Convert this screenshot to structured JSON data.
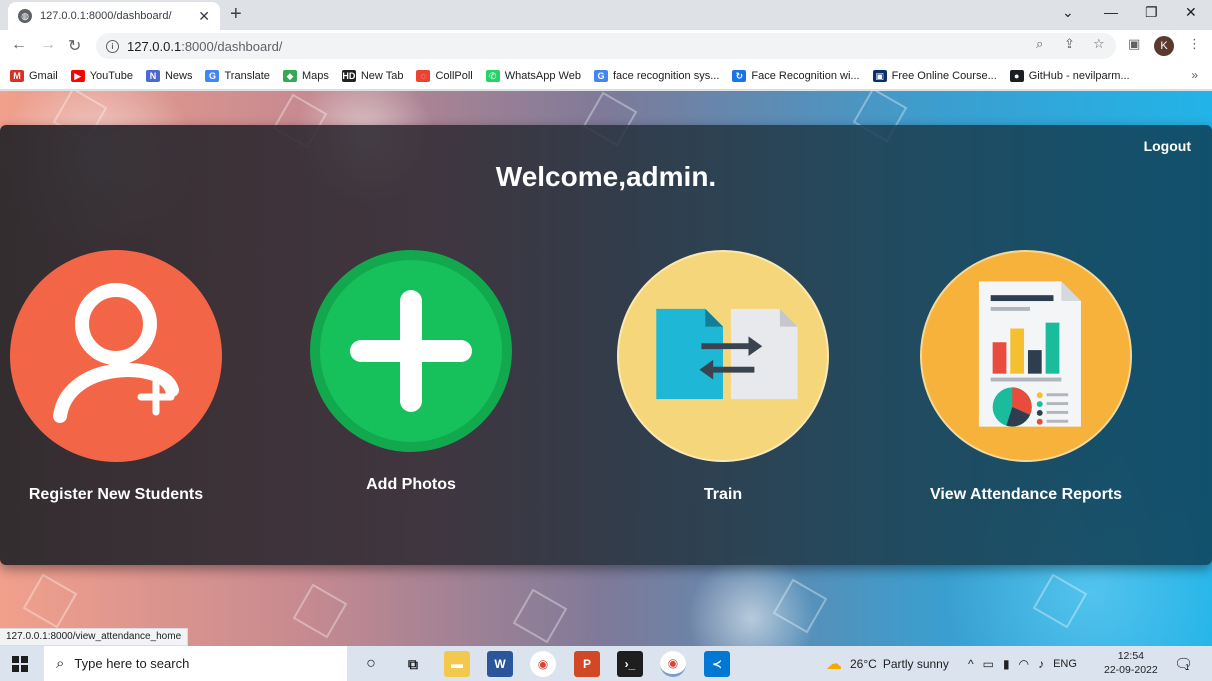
{
  "browser": {
    "tab_title": "127.0.0.1:8000/dashboard/",
    "url_host": "127.0.0.1",
    "url_rest": ":8000/dashboard/",
    "profile_initial": "K",
    "bookmarks": [
      {
        "label": "Gmail",
        "icon": "gmail-icon",
        "color": "#d93025",
        "glyph": "M"
      },
      {
        "label": "YouTube",
        "icon": "youtube-icon",
        "color": "#ff0000",
        "glyph": "▶"
      },
      {
        "label": "News",
        "icon": "news-icon",
        "color": "#4a6ad0",
        "glyph": "N"
      },
      {
        "label": "Translate",
        "icon": "translate-icon",
        "color": "#4285f4",
        "glyph": "G"
      },
      {
        "label": "Maps",
        "icon": "maps-icon",
        "color": "#34a853",
        "glyph": "◆"
      },
      {
        "label": "New Tab",
        "icon": "hd-icon",
        "color": "#202124",
        "glyph": "HD"
      },
      {
        "label": "CollPoll",
        "icon": "collpoll-icon",
        "color": "#ea4335",
        "glyph": "◌"
      },
      {
        "label": "WhatsApp Web",
        "icon": "whatsapp-icon",
        "color": "#25d366",
        "glyph": "✆"
      },
      {
        "label": "face recognition sys...",
        "icon": "google-icon",
        "color": "#4285f4",
        "glyph": "G"
      },
      {
        "label": "Face Recognition wi...",
        "icon": "face-recognition-icon",
        "color": "#1a73e8",
        "glyph": "↻"
      },
      {
        "label": "Free Online Course...",
        "icon": "courses-icon",
        "color": "#0a2f6b",
        "glyph": "▣"
      },
      {
        "label": "GitHub - nevilparm...",
        "icon": "github-icon",
        "color": "#1b1f23",
        "glyph": "●"
      }
    ],
    "status_link": "127.0.0.1:8000/view_attendance_home"
  },
  "dashboard": {
    "logout": "Logout",
    "welcome": "Welcome,admin.",
    "cards": [
      {
        "label": "Register New Students",
        "icon": "add-user-icon",
        "color": "#f36547"
      },
      {
        "label": "Add Photos",
        "icon": "plus-icon",
        "color": "#16c05a"
      },
      {
        "label": "Train",
        "icon": "transfer-files-icon",
        "color": "#f5d67a"
      },
      {
        "label": "View Attendance Reports",
        "icon": "report-chart-icon",
        "color": "#f7b23b"
      }
    ]
  },
  "taskbar": {
    "search_placeholder": "Type here to search",
    "weather_temp": "26°C",
    "weather_text": "Partly sunny",
    "language": "ENG",
    "time": "12:54",
    "date": "22-09-2022",
    "notifications": "1"
  }
}
